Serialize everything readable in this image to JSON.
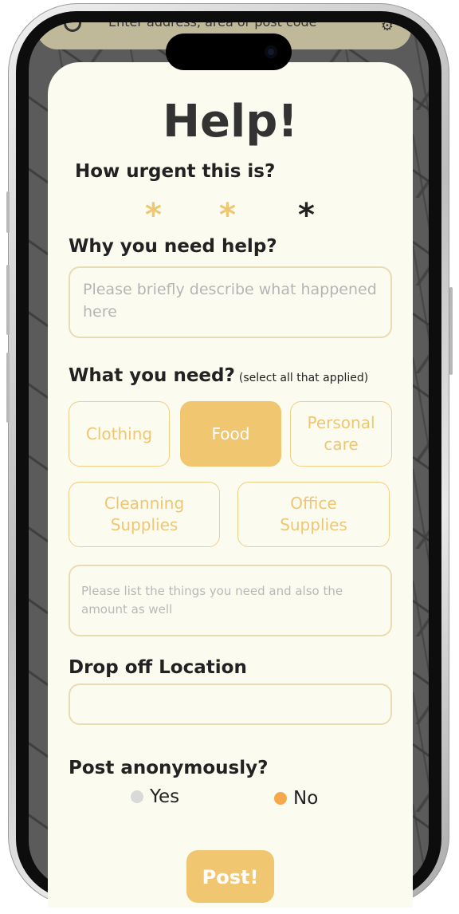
{
  "map": {
    "search_placeholder": "Enter address, area or post code"
  },
  "form": {
    "title": "Help!",
    "urgency": {
      "question": "How urgent this is?",
      "stars": [
        {
          "symbol": "*",
          "color": "#efc671"
        },
        {
          "symbol": "*",
          "color": "#efc671"
        },
        {
          "symbol": "*",
          "color": "#222222"
        }
      ]
    },
    "reason": {
      "question": "Why you need help?",
      "placeholder": "Please briefly describe what happened here"
    },
    "needs": {
      "question": "What you need?",
      "hint": "(select all that applied)",
      "options": [
        {
          "label": "Clothing",
          "selected": false
        },
        {
          "label": "Food",
          "selected": true
        },
        {
          "label": "Personal care",
          "selected": false
        },
        {
          "label": "Cleanning Supplies",
          "selected": false
        },
        {
          "label": "Office Supplies",
          "selected": false
        }
      ],
      "list_placeholder": "Please list the things you need and also the amount as well"
    },
    "dropoff": {
      "label": "Drop off Location",
      "value": ""
    },
    "anonymous": {
      "question": "Post anonymously?",
      "options": [
        {
          "label": "Yes",
          "selected": false,
          "color": "#d9d9d9"
        },
        {
          "label": "No",
          "selected": true,
          "color": "#f5a94a"
        }
      ]
    },
    "submit_label": "Post!"
  },
  "colors": {
    "accent": "#f1c670",
    "card_bg": "#fcfbef",
    "border": "#e8dcb4"
  }
}
